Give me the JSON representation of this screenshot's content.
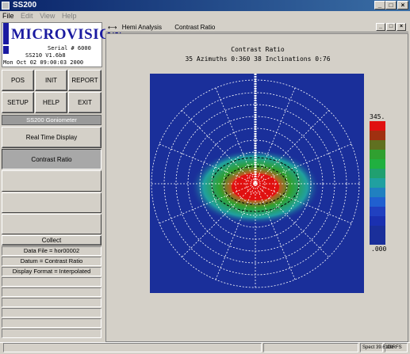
{
  "app": {
    "title": "SS200",
    "menu": [
      "File",
      "Edit",
      "View",
      "Help"
    ],
    "window_buttons": [
      "_",
      "□",
      "×"
    ]
  },
  "logo": {
    "brand": "MICROVISION",
    "serial": "Serial # 6000",
    "version": "SS210 V1.6b8",
    "date": "Mon Oct 02 09:00:03 2000"
  },
  "buttons": {
    "pos": "POS",
    "init": "INIT",
    "report": "REPORT",
    "setup": "SETUP",
    "help": "HELP",
    "exit": "EXIT"
  },
  "panel": {
    "section_title": "SS200 Goniometer",
    "real_time": "Real Time Display",
    "contrast": "Contrast Ratio",
    "collect": "Collect",
    "data_file": "Data File = hor00002",
    "datum": "Datum = Contrast Ratio",
    "display_format": "Display Format = Interpolated"
  },
  "child": {
    "title_analysis": "Hemi Analysis",
    "title_metric": "Contrast Ratio",
    "plot_title": "Contrast Ratio",
    "plot_subtitle": "35 Azimuths 0:360  38 Inclinations 0:76"
  },
  "colors": {
    "titlebar": "#0a246a",
    "plot_bg": "#1a2f9a",
    "logo": "#1a1aa0"
  },
  "chart_data": {
    "type": "heatmap",
    "title": "Contrast Ratio",
    "subtitle": "35 Azimuths 0:360  38 Inclinations 0:76",
    "colorbar": {
      "max_label": "345.",
      "min_label": ".000"
    }
  },
  "status": {
    "spect": "Spect 39.61Dc",
    "extra": "09RFS"
  }
}
